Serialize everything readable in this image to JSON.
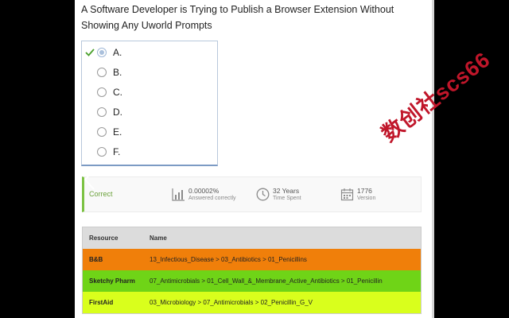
{
  "question": {
    "text": "A Software Developer is Trying to Publish a Browser Extension Without Showing Any Uworld Prompts"
  },
  "answers": [
    {
      "label": "A.",
      "selected": true,
      "correct": true
    },
    {
      "label": "B.",
      "selected": false,
      "correct": false
    },
    {
      "label": "C.",
      "selected": false,
      "correct": false
    },
    {
      "label": "D.",
      "selected": false,
      "correct": false
    },
    {
      "label": "E.",
      "selected": false,
      "correct": false
    },
    {
      "label": "F.",
      "selected": false,
      "correct": false
    }
  ],
  "stats": {
    "status": "Correct",
    "status_color": "#6aa13a",
    "percent_value": "0.00002%",
    "percent_label": "Answered correctly",
    "time_value": "32 Years",
    "time_label": "Time Spent",
    "version_value": "1776",
    "version_label": "Version",
    "icons": [
      "bar-chart-icon",
      "clock-icon",
      "calendar-icon"
    ]
  },
  "table": {
    "headers": {
      "resource": "Resource",
      "name": "Name"
    },
    "rows": [
      {
        "resource": "B&B",
        "name": "13_Infectious_Disease > 03_Antibiotics > 01_Penicillins",
        "color": "#f07f0a"
      },
      {
        "resource": "Sketchy Pharm",
        "name": "07_Antimicrobials > 01_Cell_Wall_&_Membrane_Active_Antibiotics > 01_Penicillin",
        "color": "#6fd417"
      },
      {
        "resource": "FirstAid",
        "name": "03_Microbiology > 07_Antimicrobials > 02_Penicillin_G_V",
        "color": "#d9ff1c"
      }
    ]
  },
  "watermark": {
    "text": "数创社scs66",
    "color": "#c0162a"
  }
}
